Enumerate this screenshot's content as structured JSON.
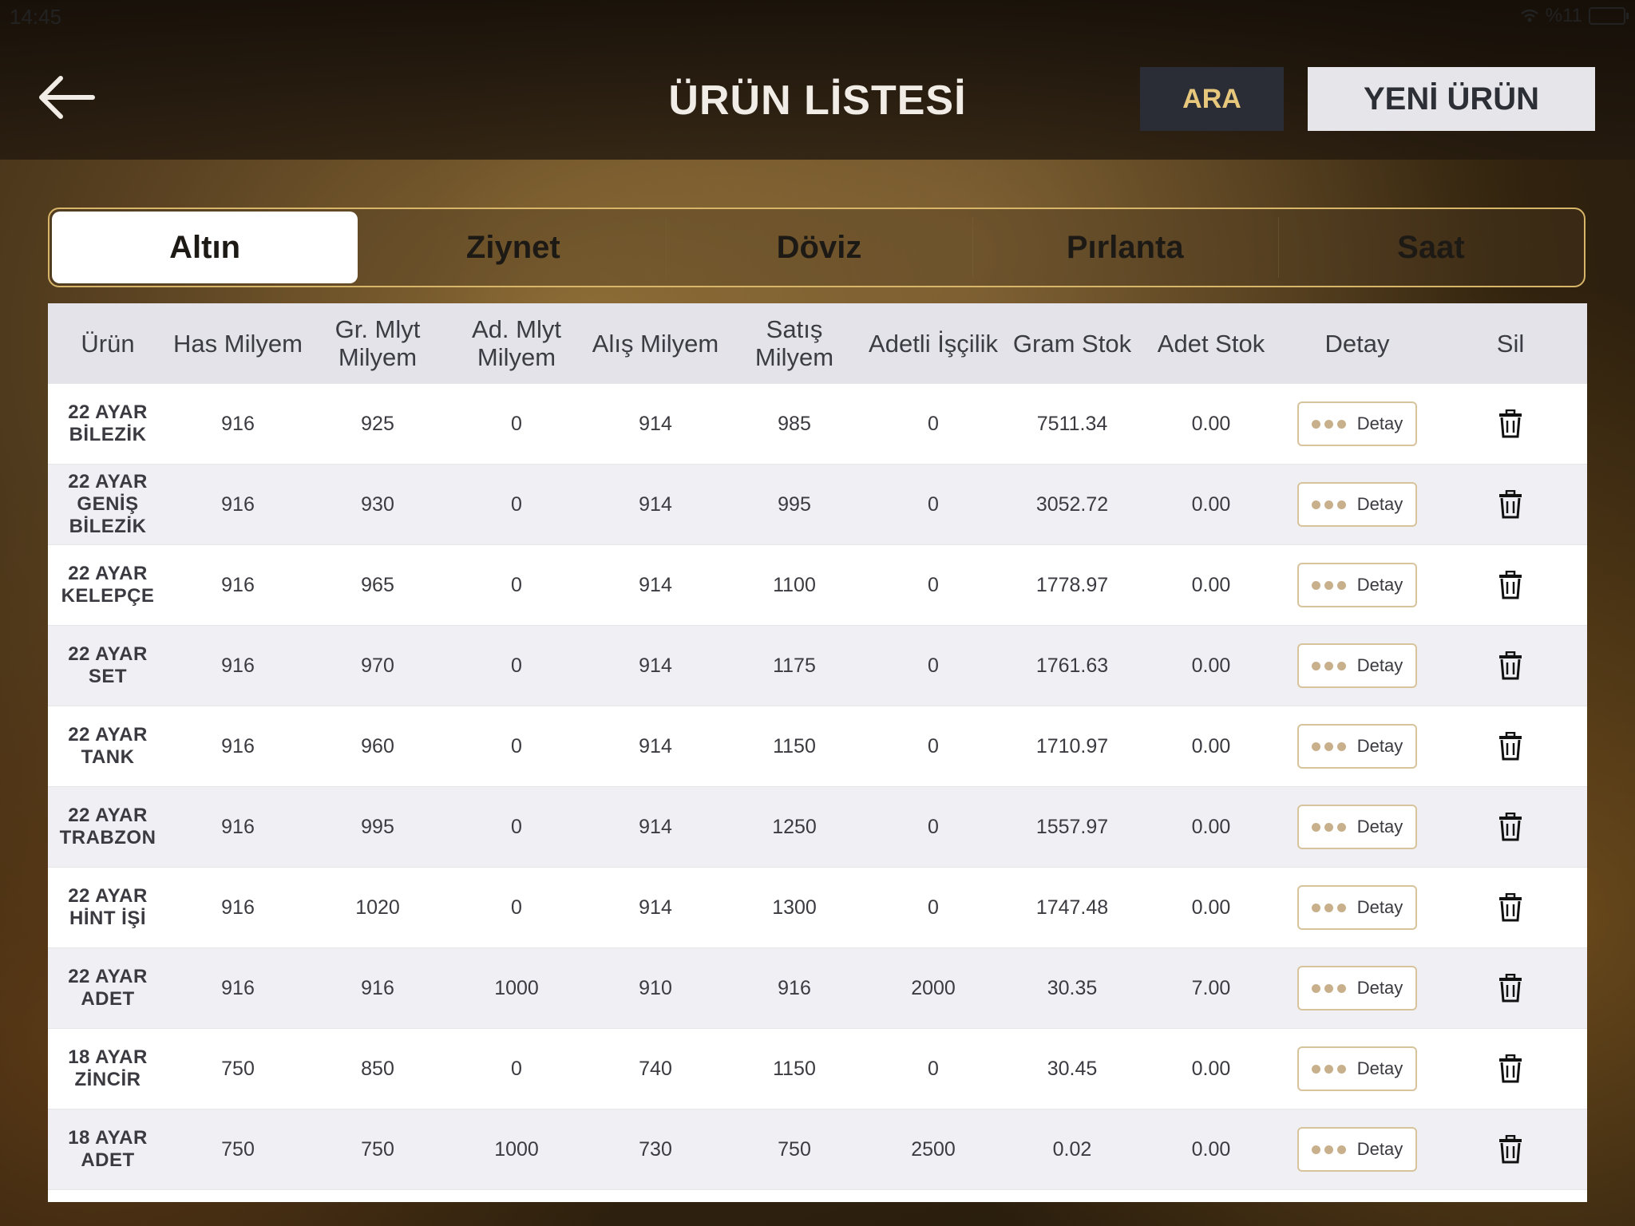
{
  "status": {
    "time": "14:45",
    "battery": "%11"
  },
  "header": {
    "title": "ÜRÜN LİSTESİ",
    "search_label": "ARA",
    "new_label": "YENİ ÜRÜN"
  },
  "tabs": [
    "Altın",
    "Ziynet",
    "Döviz",
    "Pırlanta",
    "Saat"
  ],
  "columns": [
    "Ürün",
    "Has Milyem",
    "Gr. Mlyt Milyem",
    "Ad. Mlyt Milyem",
    "Alış Milyem",
    "Satış Milyem",
    "Adetli İşçilik",
    "Gram Stok",
    "Adet Stok",
    "Detay",
    "Sil"
  ],
  "detail_label": "Detay",
  "rows": [
    {
      "name": "22 AYAR BİLEZİK",
      "has": "916",
      "gr": "925",
      "ad": "0",
      "alis": "914",
      "satis": "985",
      "iscilik": "0",
      "gram": "7511.34",
      "adet": "0.00"
    },
    {
      "name": "22 AYAR GENİŞ BİLEZİK",
      "has": "916",
      "gr": "930",
      "ad": "0",
      "alis": "914",
      "satis": "995",
      "iscilik": "0",
      "gram": "3052.72",
      "adet": "0.00"
    },
    {
      "name": "22 AYAR KELEPÇE",
      "has": "916",
      "gr": "965",
      "ad": "0",
      "alis": "914",
      "satis": "1100",
      "iscilik": "0",
      "gram": "1778.97",
      "adet": "0.00"
    },
    {
      "name": "22 AYAR SET",
      "has": "916",
      "gr": "970",
      "ad": "0",
      "alis": "914",
      "satis": "1175",
      "iscilik": "0",
      "gram": "1761.63",
      "adet": "0.00"
    },
    {
      "name": "22 AYAR TANK",
      "has": "916",
      "gr": "960",
      "ad": "0",
      "alis": "914",
      "satis": "1150",
      "iscilik": "0",
      "gram": "1710.97",
      "adet": "0.00"
    },
    {
      "name": "22 AYAR TRABZON",
      "has": "916",
      "gr": "995",
      "ad": "0",
      "alis": "914",
      "satis": "1250",
      "iscilik": "0",
      "gram": "1557.97",
      "adet": "0.00"
    },
    {
      "name": "22 AYAR HİNT İŞİ",
      "has": "916",
      "gr": "1020",
      "ad": "0",
      "alis": "914",
      "satis": "1300",
      "iscilik": "0",
      "gram": "1747.48",
      "adet": "0.00"
    },
    {
      "name": "22 AYAR ADET",
      "has": "916",
      "gr": "916",
      "ad": "1000",
      "alis": "910",
      "satis": "916",
      "iscilik": "2000",
      "gram": "30.35",
      "adet": "7.00"
    },
    {
      "name": "18 AYAR ZİNCİR",
      "has": "750",
      "gr": "850",
      "ad": "0",
      "alis": "740",
      "satis": "1150",
      "iscilik": "0",
      "gram": "30.45",
      "adet": "0.00"
    },
    {
      "name": "18 AYAR ADET",
      "has": "750",
      "gr": "750",
      "ad": "1000",
      "alis": "730",
      "satis": "750",
      "iscilik": "2500",
      "gram": "0.02",
      "adet": "0.00"
    }
  ],
  "colors": {
    "accent": "#d7b569",
    "search_bg": "#2a2d36",
    "search_text": "#e6c77c",
    "header_row": "#e3e3e9"
  }
}
